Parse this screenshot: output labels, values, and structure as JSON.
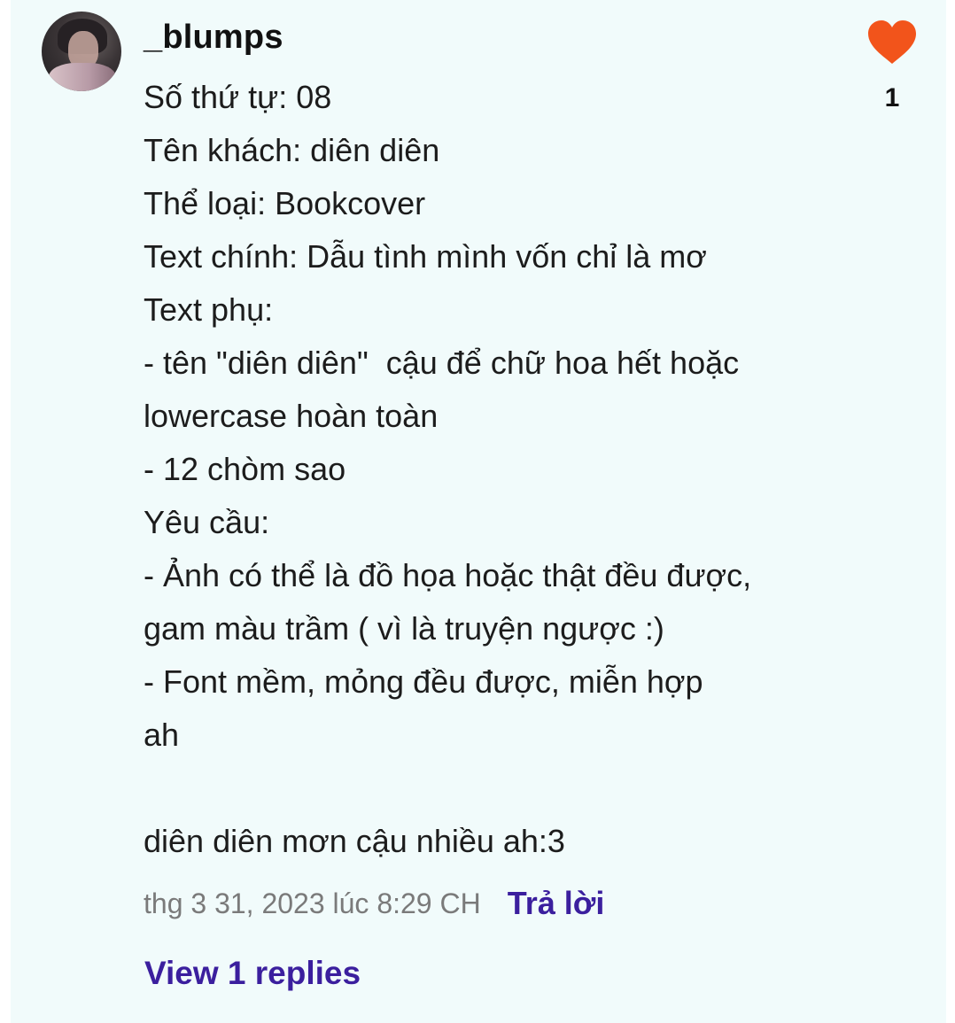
{
  "comment": {
    "username": "_blumps",
    "lines": [
      "Số thứ tự: 08",
      "Tên khách: diên diên",
      "Thể loại: Bookcover",
      "Text chính: Dẫu tình mình vốn chỉ là mơ",
      "Text phụ:",
      "- tên \"diên diên\"  cậu để chữ hoa hết hoặc",
      "lowercase hoàn toàn",
      "- 12 chòm sao",
      "Yêu cầu:",
      "- Ảnh có thể là đồ họa hoặc thật đều được,",
      "gam màu trầm ( vì là truyện ngược :)",
      "- Font mềm, mỏng đều được, miễn hợp",
      "ah",
      "",
      "diên diên mơn cậu nhiều ah:3"
    ],
    "timestamp": "thg 3 31, 2023 lúc 8:29 CH",
    "reply_label": "Trả lời",
    "view_replies_label": "View 1 replies",
    "like_count": "1",
    "avatar_icon": "user-avatar-photo",
    "like_icon": "heart-icon"
  },
  "colors": {
    "background": "#f1fbfb",
    "accent_link": "#3b1f9e",
    "heart": "#f2541b",
    "timestamp": "#7a7a7a"
  }
}
